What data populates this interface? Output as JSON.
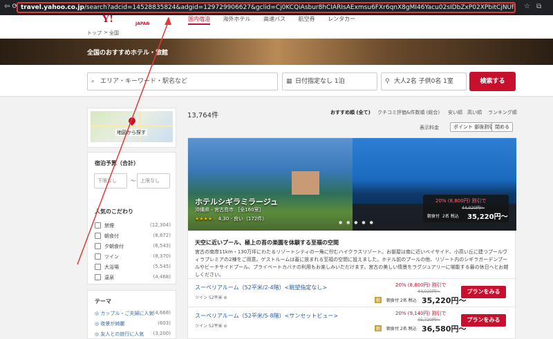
{
  "browser": {
    "nav_glyph": "⇦  ⟳",
    "url_host": "travel.yahoo.co.jp",
    "url_rest": "/search?adcid=14528835824&adgid=129729906627&gclid=Cj0KCQiAsbur8hCIARIsAExmsu6FXr6qnX8gMI46Yacu02sIDbZxP02XPbitCjNUfe_8w84n1q-PYBsaAu4IEALw_wcB&ikCo=y_google",
    "ext_icons": [
      "☆",
      "⧉"
    ]
  },
  "site": {
    "logo": "Y!",
    "logo_sub": "JAPAN",
    "nav": [
      "国内宿泊",
      "海外ホテル",
      "高速バス",
      "航空券",
      "レンタカー"
    ]
  },
  "breadcrumb": [
    "トップ",
    "全国"
  ],
  "hero": {
    "title": "全国のおすすめホテル・旅館"
  },
  "search": {
    "keyword_placeholder": "エリア・キーワード・駅名など",
    "date": "日付指定なし 1泊",
    "guests": "大人2名 子供0名 1室",
    "button": "検索する"
  },
  "sidebar": {
    "map_label": "地図から探す",
    "budget_title": "宿泊予算（合計）",
    "budget_min": "下限なし",
    "budget_sep": "〜",
    "budget_max": "上限なし",
    "popular_title": "人気のこだわり",
    "popular": [
      {
        "label": "禁煙",
        "count": "(12,304)"
      },
      {
        "label": "朝食付",
        "count": "(8,872)"
      },
      {
        "label": "夕朝食付",
        "count": "(6,543)"
      },
      {
        "label": "ツイン",
        "count": "(8,370)"
      },
      {
        "label": "大浴場",
        "count": "(5,545)"
      },
      {
        "label": "温泉",
        "count": "(4,468)"
      }
    ],
    "theme_title": "テーマ",
    "themes": [
      {
        "label": "カップル・ご夫婦に人気",
        "count": "(4,668)"
      },
      {
        "label": "夜景が綺麗",
        "count": "(603)"
      },
      {
        "label": "友人との旅行に人気",
        "count": "(3,200)"
      }
    ]
  },
  "results": {
    "count": "13,764件",
    "sort": [
      "おすすめ順 (全て)",
      "クチコミ評価&件数順 (総合)",
      "安い順",
      "高い順",
      "ランキング順"
    ],
    "display_label": "表示料金",
    "display_options": [
      "ポイント 部後割引",
      "閉める"
    ]
  },
  "hotel": {
    "name": "ホテルシギラミラージュ",
    "address": "沖縄県・宮古島市 ［全160室］",
    "stars": "★★★★☆",
    "rating": "4.30 · 良い（172件）",
    "dots": "● ● ● ● ●",
    "photo_price": {
      "discount": "20% (8,800円) 割引で",
      "old": "44,020円〜",
      "meal": "朝食付",
      "people": "2名 税込",
      "price": "35,220円〜"
    },
    "catch": "天空に近いプール、極上の苔の楽園を体験する至福の空間",
    "description": "宮古の南岸11km・130万坪にわたるリゾートシティの一角に佇むハイクラスリゾート。お部屋は南に近いベイサイド、小高い丘に建つプールヴィラプレミアの2棟をご用意。ゲストルームは蓋に放まれる至福の空間に設えました。ホテル前のプールの他、リゾート内のシギラガーデンプールやビーチサイドプール、プライベートカバナの利用もお楽しみいただけます。宮古の美しい情景をラグジュアリーに堪能する最の休日へとお越しください。",
    "plans": [
      {
        "name": "スーペリアルーム（52平米/2-4階）<眺望指定なし>",
        "tags": "ツイン 52平米 ⊘",
        "discount": "20% (8,800円) 割引で",
        "old": "44,020円〜",
        "meal": "朝",
        "people": "朝食付 2名 税込",
        "price": "35,220円〜",
        "button": "プランをみる"
      },
      {
        "name": "スーペリアルーム（52平米/5-8階）<サンセットビュー>",
        "tags": "ツイン 52平米 ⊘",
        "discount": "20% (9,140円) 割引で",
        "old": "45,720円〜",
        "meal": "朝",
        "people": "朝食付 2名 税込",
        "price": "36,580円〜",
        "button": "プランをみる"
      }
    ]
  },
  "colors": {
    "accent": "#c8102e",
    "annotation": "#e53935"
  }
}
